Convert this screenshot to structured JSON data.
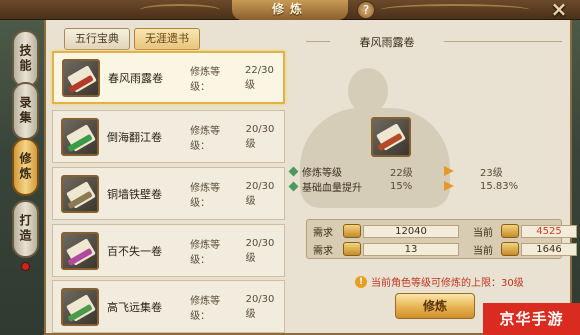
{
  "window": {
    "title": "修炼",
    "help_label": "?",
    "close_label": "×"
  },
  "side_tabs": [
    {
      "label": "技能",
      "active": false
    },
    {
      "label": "录集",
      "active": false
    },
    {
      "label": "修炼",
      "active": true
    },
    {
      "label": "打造",
      "active": false
    }
  ],
  "tabs": [
    {
      "label": "五行宝典",
      "active": false
    },
    {
      "label": "无涯遗书",
      "active": true
    }
  ],
  "list": {
    "level_label": "修炼等级：",
    "items": [
      {
        "name": "春风雨露卷",
        "level": "22/30级",
        "band_color": "#b43a2a",
        "selected": true
      },
      {
        "name": "倒海翻江卷",
        "level": "20/30级",
        "band_color": "#3b9a48",
        "selected": false
      },
      {
        "name": "铜墙铁壁卷",
        "level": "20/30级",
        "band_color": "#8a7a52",
        "selected": false
      },
      {
        "name": "百不失一卷",
        "level": "20/30级",
        "band_color": "#b04aa0",
        "selected": false
      },
      {
        "name": "高飞远集卷",
        "level": "20/30级",
        "band_color": "#4a9a4a",
        "selected": false
      }
    ]
  },
  "detail": {
    "title": "春风雨露卷",
    "stats": [
      {
        "label": "修炼等级",
        "from": "22级",
        "to": "23级"
      },
      {
        "label": "基础血量提升",
        "from": "15%",
        "to": "15.83%"
      }
    ],
    "requirements": [
      {
        "label": "需求",
        "amount": "12040",
        "current_label": "当前",
        "current": "4525",
        "current_color": "#d33a2a"
      },
      {
        "label": "需求",
        "amount": "13",
        "current_label": "当前",
        "current": "1646",
        "current_color": "#3b2d19"
      }
    ],
    "warning": "当前角色等级可修炼的上限：30级",
    "warning_icon": "!",
    "button_label": "修炼"
  },
  "watermark": "京华手游"
}
